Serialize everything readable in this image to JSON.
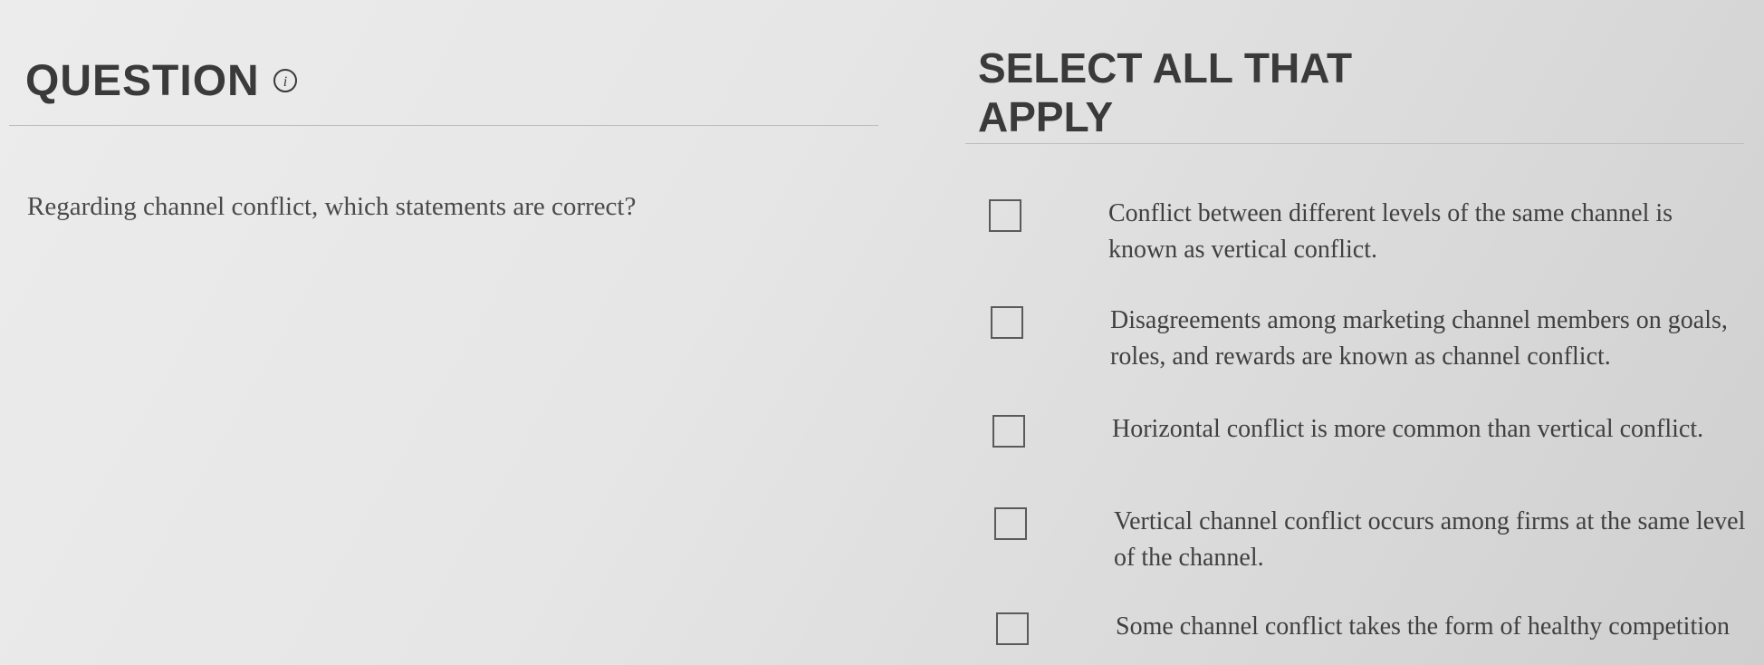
{
  "question": {
    "title": "QUESTION",
    "text": "Regarding channel conflict, which statements are correct?"
  },
  "answers": {
    "header": "SELECT ALL THAT APPLY",
    "options": [
      {
        "label": "Conflict between different levels of the same channel is known as vertical conflict.",
        "checked": false
      },
      {
        "label": "Disagreements among marketing channel members on goals, roles, and rewards are known as channel conflict.",
        "checked": false
      },
      {
        "label": "Horizontal conflict is more common than vertical conflict.",
        "checked": false
      },
      {
        "label": "Vertical channel conflict occurs among firms at the same level of the channel.",
        "checked": false
      },
      {
        "label": "Some channel conflict takes the form of healthy competition",
        "checked": false
      }
    ]
  },
  "icons": {
    "info": "info-icon"
  }
}
